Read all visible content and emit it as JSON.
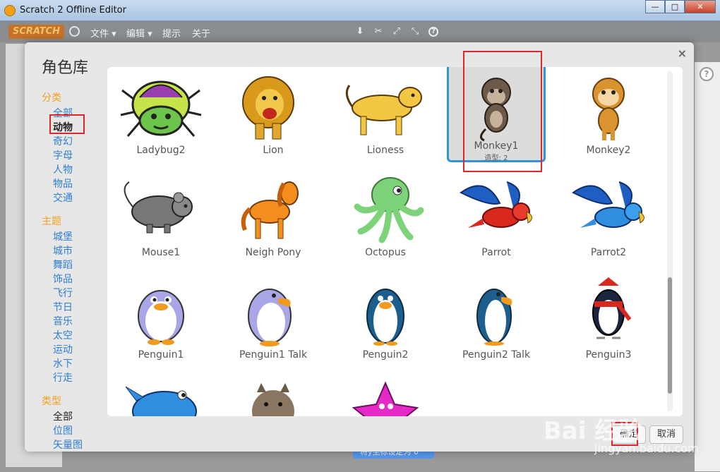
{
  "window": {
    "title": "Scratch 2 Offline Editor",
    "controls": [
      "—",
      "□",
      "✕"
    ]
  },
  "menubar": {
    "logo": "SCRATCH",
    "items": [
      "文件 ▾",
      "编辑 ▾",
      "提示",
      "关于"
    ],
    "tools": [
      "stamp-icon",
      "cut-icon",
      "grow-icon",
      "shrink-icon",
      "help-icon"
    ]
  },
  "background": {
    "block_text": "将y坐标设定为 0"
  },
  "modal": {
    "title": "角色库",
    "close": "×",
    "sidebar": {
      "category_heading": "分类",
      "categories": [
        "全部",
        "动物",
        "奇幻",
        "字母",
        "人物",
        "物品",
        "交通"
      ],
      "active_category": "动物",
      "theme_heading": "主题",
      "themes": [
        "城堡",
        "城市",
        "舞蹈",
        "饰品",
        "飞行",
        "节日",
        "音乐",
        "太空",
        "运动",
        "水下",
        "行走"
      ],
      "type_heading": "类型",
      "types": [
        "全部",
        "位图",
        "矢量图"
      ],
      "active_type": "全部"
    },
    "sprites": [
      {
        "name": "Ladybug2",
        "icon": "ladybug-icon"
      },
      {
        "name": "Lion",
        "icon": "lion-icon"
      },
      {
        "name": "Lioness",
        "icon": "lioness-icon"
      },
      {
        "name": "Monkey1",
        "icon": "monkey-icon",
        "selected": true,
        "costumes": "造型: 2"
      },
      {
        "name": "Monkey2",
        "icon": "monkey-icon"
      },
      {
        "name": "Mouse1",
        "icon": "mouse-icon"
      },
      {
        "name": "Neigh Pony",
        "icon": "pony-icon"
      },
      {
        "name": "Octopus",
        "icon": "octopus-icon"
      },
      {
        "name": "Parrot",
        "icon": "parrot-icon"
      },
      {
        "name": "Parrot2",
        "icon": "parrot-icon"
      },
      {
        "name": "Penguin1",
        "icon": "penguin-icon"
      },
      {
        "name": "Penguin1 Talk",
        "icon": "penguin-icon"
      },
      {
        "name": "Penguin2",
        "icon": "penguin-icon"
      },
      {
        "name": "Penguin2 Talk",
        "icon": "penguin-icon"
      },
      {
        "name": "Penguin3",
        "icon": "penguin-icon"
      },
      {
        "name": "",
        "icon": "shark-icon"
      },
      {
        "name": "",
        "icon": "squirrel-icon"
      },
      {
        "name": "",
        "icon": "starfish-icon"
      }
    ],
    "ok_label": "确定",
    "cancel_label": "取消"
  },
  "watermark": {
    "brand": "Bai 经验",
    "url": "jingyan.baidu.com"
  },
  "colors": {
    "accent": "#2f93d6",
    "heading": "#f3a021",
    "link": "#2e7fd4",
    "annotation": "#e0262a"
  }
}
